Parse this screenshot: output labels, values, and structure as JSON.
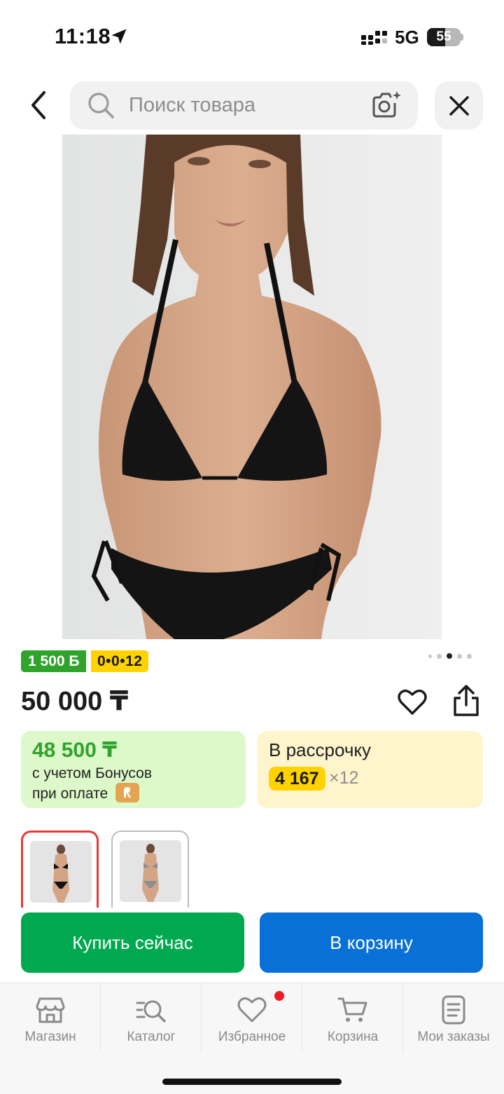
{
  "status_bar": {
    "time": "11:18",
    "network": "5G",
    "battery": "55",
    "battery_level": 0.55
  },
  "search": {
    "placeholder": "Поиск товара",
    "value": ""
  },
  "product": {
    "bonus_badge": "1 500 Б",
    "installment_badge": "0•0•12",
    "price": "50 000 ₸",
    "gallery": {
      "count": 5,
      "active_index": 2
    }
  },
  "bonus_card": {
    "amount": "48 500 ₸",
    "line1": "с учетом Бонусов",
    "line2": "при оплате"
  },
  "installment_card": {
    "title": "В рассрочку",
    "monthly": "4 167",
    "months": "×12"
  },
  "thumbnails": [
    {
      "selected": true
    },
    {
      "selected": false
    }
  ],
  "actions": {
    "buy_now": "Купить сейчас",
    "add_to_cart": "В корзину"
  },
  "tabs": [
    {
      "label": "Магазин",
      "icon": "store-icon"
    },
    {
      "label": "Каталог",
      "icon": "catalog-search-icon"
    },
    {
      "label": "Избранное",
      "icon": "heart-icon",
      "has_badge": true
    },
    {
      "label": "Корзина",
      "icon": "cart-icon"
    },
    {
      "label": "Мои заказы",
      "icon": "orders-icon"
    }
  ],
  "colors": {
    "accent_green": "#00a94f",
    "accent_blue": "#0870d6",
    "bonus_green": "#2fa32c",
    "installment_yellow": "#ffd200",
    "selected_red": "#e53935"
  }
}
